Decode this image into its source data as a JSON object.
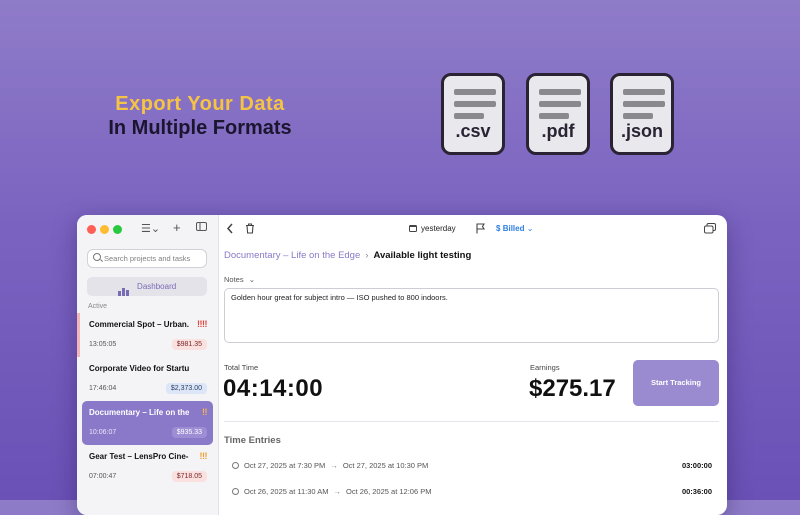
{
  "promo": {
    "line1": "Export Your Data",
    "line2": "In Multiple Formats",
    "formats": [
      ".csv",
      ".pdf",
      ".json"
    ]
  },
  "colors": {
    "accent": "#8a79c8",
    "button": "#9a8bd0",
    "promo_yellow": "#f6c443",
    "billed_blue": "#2f7fe5"
  },
  "sidebar": {
    "search_placeholder": "Search projects and tasks",
    "dashboard_label": "Dashboard",
    "section_label": "Active",
    "items": [
      {
        "title": "Commercial Spot – Urban...",
        "priority": "!!!!",
        "time": "13:05:05",
        "amount": "$981.35"
      },
      {
        "title": "Corporate Video for Startup...",
        "priority": "",
        "time": "17:46:04",
        "amount": "$2,373.00"
      },
      {
        "title": "Documentary – Life on the...",
        "priority": "!!",
        "time": "10:06:07",
        "amount": "$935.33"
      },
      {
        "title": "Gear Test – LensPro Cine-...",
        "priority": "!!!",
        "time": "07:00:47",
        "amount": "$718.05"
      }
    ]
  },
  "toolbar": {
    "date_label": "yesterday",
    "billed_label": "Billed"
  },
  "breadcrumb": {
    "project": "Documentary – Life on the Edge",
    "task": "Available light testing"
  },
  "notes": {
    "label": "Notes",
    "value": "Golden hour great for subject intro — ISO pushed to 800 indoors."
  },
  "stats": {
    "total_time_label": "Total Time",
    "total_time": "04:14:00",
    "earnings_label": "Earnings",
    "earnings": "$275.17",
    "start_label": "Start Tracking"
  },
  "time_entries": {
    "label": "Time Entries",
    "entries": [
      {
        "start": "Oct 27, 2025 at 7:30 PM",
        "end": "Oct 27, 2025 at 10:30 PM",
        "duration": "03:00:00"
      },
      {
        "start": "Oct 26, 2025 at 11:30 AM",
        "end": "Oct 26, 2025 at 12:06 PM",
        "duration": "00:36:00"
      }
    ]
  }
}
